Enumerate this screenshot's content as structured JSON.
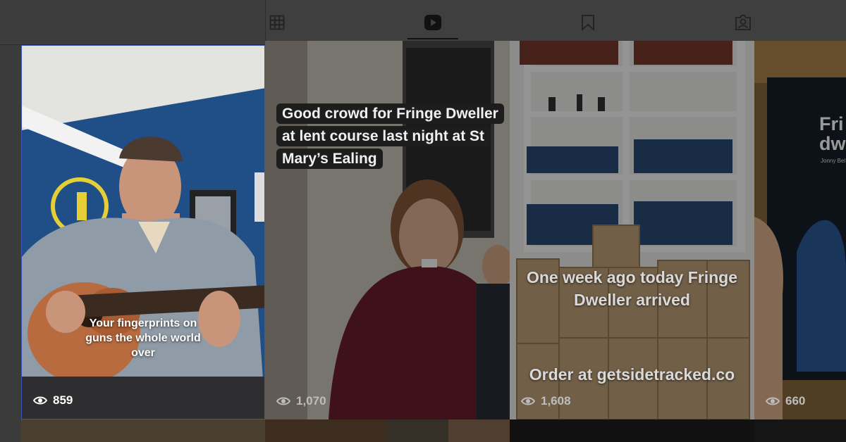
{
  "tabs": [
    {
      "name": "posts",
      "icon": "grid-icon",
      "active": false
    },
    {
      "name": "reels",
      "icon": "reels-play-icon",
      "active": true
    },
    {
      "name": "saved",
      "icon": "bookmark-icon",
      "active": false
    },
    {
      "name": "tagged",
      "icon": "tagged-user-icon",
      "active": false
    }
  ],
  "reels": [
    {
      "caption": "Your fingerprints on guns the whole world over",
      "views": "859"
    },
    {
      "caption": "Good crowd for Fringe Dweller at lent course last night at St Mary’s Ealing",
      "views": "1,070"
    },
    {
      "caption": "One week ago today Fringe Dweller arrived",
      "caption2": "Order at getsidetracked.co",
      "views": "1,608"
    },
    {
      "cover_title": "Fri dw",
      "cover_author": "Jonny Bel",
      "views": "660"
    }
  ],
  "colors": {
    "accent_border": "#3b57b3",
    "tab_active": "#111111",
    "caption_bg": "#1d1d1d"
  }
}
